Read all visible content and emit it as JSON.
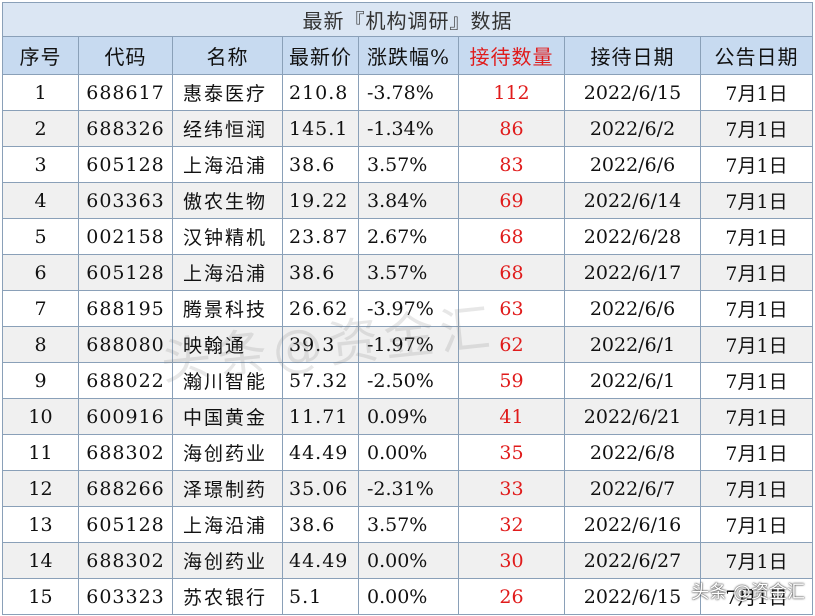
{
  "title": "最新『机构调研』数据",
  "headers": [
    "序号",
    "代码",
    "名称",
    "最新价",
    "涨跌幅%",
    "接待数量",
    "接待日期",
    "公告日期"
  ],
  "rows": [
    [
      "1",
      "688617",
      "惠泰医疗",
      "210.8",
      "-3.78%",
      "112",
      "2022/6/15",
      "7月1日"
    ],
    [
      "2",
      "688326",
      "经纬恒润",
      "145.1",
      "-1.34%",
      "86",
      "2022/6/2",
      "7月1日"
    ],
    [
      "3",
      "605128",
      "上海沿浦",
      "38.6",
      "3.57%",
      "83",
      "2022/6/6",
      "7月1日"
    ],
    [
      "4",
      "603363",
      "傲农生物",
      "19.22",
      "3.84%",
      "69",
      "2022/6/14",
      "7月1日"
    ],
    [
      "5",
      "002158",
      "汉钟精机",
      "23.87",
      "2.67%",
      "68",
      "2022/6/28",
      "7月1日"
    ],
    [
      "6",
      "605128",
      "上海沿浦",
      "38.6",
      "3.57%",
      "68",
      "2022/6/17",
      "7月1日"
    ],
    [
      "7",
      "688195",
      "腾景科技",
      "26.62",
      "-3.97%",
      "63",
      "2022/6/6",
      "7月1日"
    ],
    [
      "8",
      "688080",
      "映翰通",
      "39.3",
      "-1.97%",
      "62",
      "2022/6/1",
      "7月1日"
    ],
    [
      "9",
      "688022",
      "瀚川智能",
      "57.32",
      "-2.50%",
      "59",
      "2022/6/1",
      "7月1日"
    ],
    [
      "10",
      "600916",
      "中国黄金",
      "11.71",
      "0.09%",
      "41",
      "2022/6/21",
      "7月1日"
    ],
    [
      "11",
      "688302",
      "海创药业",
      "44.49",
      "0.00%",
      "35",
      "2022/6/8",
      "7月1日"
    ],
    [
      "12",
      "688266",
      "泽璟制药",
      "35.06",
      "-2.31%",
      "33",
      "2022/6/7",
      "7月1日"
    ],
    [
      "13",
      "605128",
      "上海沿浦",
      "38.6",
      "3.57%",
      "32",
      "2022/6/16",
      "7月1日"
    ],
    [
      "14",
      "688302",
      "海创药业",
      "44.49",
      "0.00%",
      "30",
      "2022/6/27",
      "7月1日"
    ],
    [
      "15",
      "603323",
      "苏农银行",
      "5.1",
      "0.00%",
      "26",
      "2022/6/15",
      "7月1日"
    ]
  ],
  "watermark": "头条@资金汇",
  "corner_watermark": "头条 @资金汇",
  "colors": {
    "header_bg": "#c7daf0",
    "highlight": "#e01b1b",
    "stripe": "#f0f0f0"
  }
}
